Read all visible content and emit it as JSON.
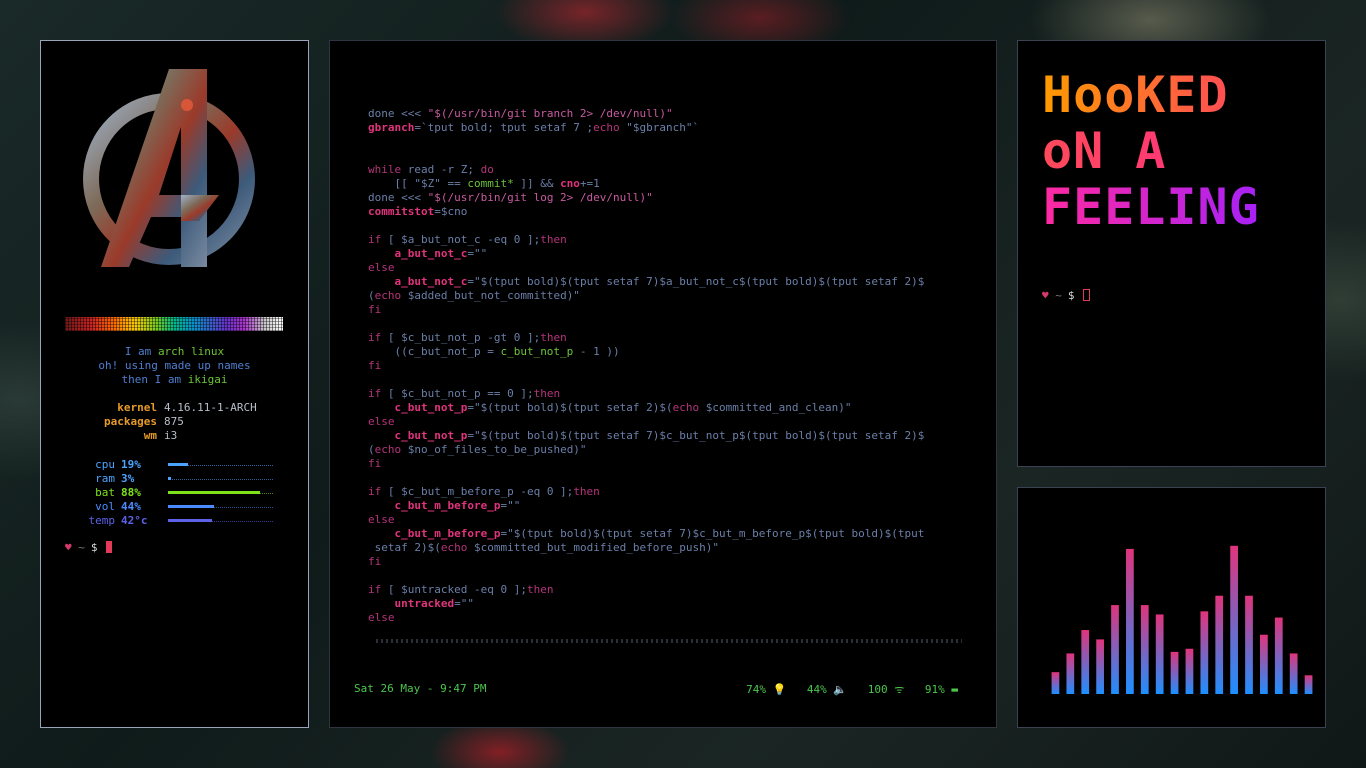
{
  "left_panel": {
    "intro": {
      "line1_pre": "I am ",
      "line1_hl": "arch linux",
      "line2": "oh! using made up names",
      "line3_pre": "then I am ",
      "line3_hl": "ikigai"
    },
    "sysinfo": [
      {
        "key": "kernel",
        "value": "4.16.11-1-ARCH"
      },
      {
        "key": "packages",
        "value": "875"
      },
      {
        "key": "wm",
        "value": "i3"
      }
    ],
    "stats": [
      {
        "label": "cpu",
        "value": "19%",
        "level": 0.19,
        "color": "#4aa3ff"
      },
      {
        "label": "ram",
        "value": "3%",
        "level": 0.03,
        "color": "#4aa3ff"
      },
      {
        "label": "bat",
        "value": "88%",
        "level": 0.88,
        "color": "#7ee21a"
      },
      {
        "label": "vol",
        "value": "44%",
        "level": 0.44,
        "color": "#4a8cff"
      },
      {
        "label": "temp",
        "value": "42°c",
        "level": 0.42,
        "color": "#5b62e8"
      }
    ],
    "prompt": {
      "heart": "♥",
      "tilde": "~",
      "dollar": "$"
    }
  },
  "editor": {
    "lines": [
      [
        [
          "t",
          "done <<< "
        ],
        [
          "s",
          "\"$(/usr/bin/git branch 2> /dev/null)\""
        ]
      ],
      [
        [
          "v",
          "gbranch"
        ],
        [
          "t",
          "=`tput bold; tput setaf 7 ;"
        ],
        [
          "k",
          "echo"
        ],
        [
          "t",
          " \"$gbranch\"`"
        ]
      ],
      [
        [
          "t",
          ""
        ]
      ],
      [
        [
          "t",
          ""
        ]
      ],
      [
        [
          "k",
          "while"
        ],
        [
          "t",
          " read -r Z; "
        ],
        [
          "k",
          "do"
        ]
      ],
      [
        [
          "t",
          "    [[ \"$Z\" == "
        ],
        [
          "g",
          "commit*"
        ],
        [
          "t",
          " ]] && "
        ],
        [
          "v",
          "cno"
        ],
        [
          "t",
          "+=1"
        ]
      ],
      [
        [
          "t",
          "done <<< "
        ],
        [
          "s",
          "\"$(/usr/bin/git log 2> /dev/null)\""
        ]
      ],
      [
        [
          "v",
          "commitstot"
        ],
        [
          "t",
          "=$cno"
        ]
      ],
      [
        [
          "t",
          ""
        ]
      ],
      [
        [
          "k",
          "if"
        ],
        [
          "t",
          " [ $a_but_not_c -eq 0 ];"
        ],
        [
          "k",
          "then"
        ]
      ],
      [
        [
          "t",
          "    "
        ],
        [
          "v",
          "a_but_not_c"
        ],
        [
          "t",
          "=\"\""
        ]
      ],
      [
        [
          "k",
          "else"
        ]
      ],
      [
        [
          "t",
          "    "
        ],
        [
          "v",
          "a_but_not_c"
        ],
        [
          "t",
          "=\"$(tput bold)$(tput setaf 7)$a_but_not_c$(tput bold)$(tput setaf 2)$"
        ]
      ],
      [
        [
          "t",
          "("
        ],
        [
          "k",
          "echo"
        ],
        [
          "t",
          " $added_but_not_committed)\""
        ]
      ],
      [
        [
          "k",
          "fi"
        ]
      ],
      [
        [
          "t",
          ""
        ]
      ],
      [
        [
          "k",
          "if"
        ],
        [
          "t",
          " [ $c_but_not_p -gt 0 ];"
        ],
        [
          "k",
          "then"
        ]
      ],
      [
        [
          "t",
          "    ((c_but_not_p = "
        ],
        [
          "g",
          "c_but_not_p"
        ],
        [
          "t",
          " - 1 ))"
        ]
      ],
      [
        [
          "k",
          "fi"
        ]
      ],
      [
        [
          "t",
          ""
        ]
      ],
      [
        [
          "k",
          "if"
        ],
        [
          "t",
          " [ $c_but_not_p == 0 ];"
        ],
        [
          "k",
          "then"
        ]
      ],
      [
        [
          "t",
          "    "
        ],
        [
          "v",
          "c_but_not_p"
        ],
        [
          "t",
          "=\"$(tput bold)$(tput setaf 2)$("
        ],
        [
          "k",
          "echo"
        ],
        [
          "t",
          " $committed_and_clean)\""
        ]
      ],
      [
        [
          "k",
          "else"
        ]
      ],
      [
        [
          "t",
          "    "
        ],
        [
          "v",
          "c_but_not_p"
        ],
        [
          "t",
          "=\"$(tput bold)$(tput setaf 7)$c_but_not_p$(tput bold)$(tput setaf 2)$"
        ]
      ],
      [
        [
          "t",
          "("
        ],
        [
          "k",
          "echo"
        ],
        [
          "t",
          " $no_of_files_to_be_pushed)\""
        ]
      ],
      [
        [
          "k",
          "fi"
        ]
      ],
      [
        [
          "t",
          ""
        ]
      ],
      [
        [
          "k",
          "if"
        ],
        [
          "t",
          " [ $c_but_m_before_p -eq 0 ];"
        ],
        [
          "k",
          "then"
        ]
      ],
      [
        [
          "t",
          "    "
        ],
        [
          "v",
          "c_but_m_before_p"
        ],
        [
          "t",
          "=\"\""
        ]
      ],
      [
        [
          "k",
          "else"
        ]
      ],
      [
        [
          "t",
          "    "
        ],
        [
          "v",
          "c_but_m_before_p"
        ],
        [
          "t",
          "=\"$(tput bold)$(tput setaf 7)$c_but_m_before_p$(tput bold)$(tput"
        ]
      ],
      [
        [
          "t",
          " setaf 2)$("
        ],
        [
          "k",
          "echo"
        ],
        [
          "t",
          " $committed_but_modified_before_push)\""
        ]
      ],
      [
        [
          "k",
          "fi"
        ]
      ],
      [
        [
          "t",
          ""
        ]
      ],
      [
        [
          "k",
          "if"
        ],
        [
          "t",
          " [ $untracked -eq 0 ];"
        ],
        [
          "k",
          "then"
        ]
      ],
      [
        [
          "t",
          "    "
        ],
        [
          "v",
          "untracked"
        ],
        [
          "t",
          "=\"\""
        ]
      ],
      [
        [
          "k",
          "else"
        ]
      ]
    ],
    "status": {
      "datetime": "Sat 26 May -  9:47 PM",
      "brightness": "74% 💡",
      "volume": "44% 🔈",
      "wifi": "100 ᯤ",
      "battery": "91% ▬"
    }
  },
  "banner": {
    "line1": "HooKED",
    "line2": "oN A",
    "line3": "FEELING"
  },
  "visualizer": {
    "bars": [
      0.14,
      0.26,
      0.41,
      0.35,
      0.57,
      0.93,
      0.57,
      0.51,
      0.27,
      0.29,
      0.53,
      0.63,
      0.95,
      0.63,
      0.38,
      0.49,
      0.26,
      0.12
    ],
    "color_bottom": "#1f8fff",
    "color_top": "#e0347c"
  },
  "accent_colors": {
    "prompt_heart": "#d63a6b",
    "keyword": "#b3357a",
    "variable": "#e0347c",
    "status": "#4cc64c"
  }
}
